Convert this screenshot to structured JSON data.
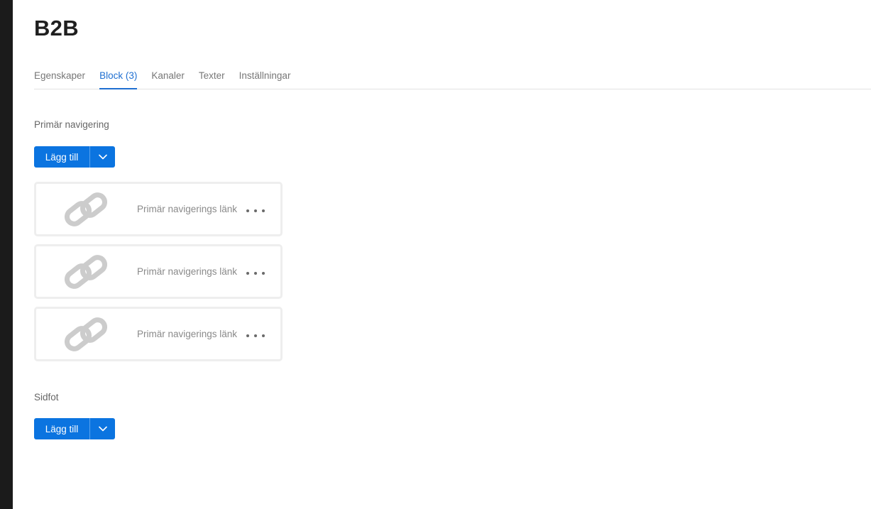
{
  "page": {
    "title": "B2B"
  },
  "tabs": [
    {
      "label": "Egenskaper",
      "active": false
    },
    {
      "label": "Block (3)",
      "active": true
    },
    {
      "label": "Kanaler",
      "active": false
    },
    {
      "label": "Texter",
      "active": false
    },
    {
      "label": "Inställningar",
      "active": false
    }
  ],
  "sections": {
    "primary": {
      "label": "Primär navigering",
      "add_label": "Lägg till",
      "blocks": [
        {
          "label": "Primär navigerings länk",
          "icon": "link-icon"
        },
        {
          "label": "Primär navigerings länk",
          "icon": "link-icon"
        },
        {
          "label": "Primär navigerings länk",
          "icon": "link-icon"
        }
      ]
    },
    "footer": {
      "label": "Sidfot",
      "add_label": "Lägg till"
    }
  },
  "colors": {
    "accent": "#1f6fd1",
    "button": "#0b74e0",
    "card_border": "#eeeeee",
    "icon": "#cccccc"
  }
}
